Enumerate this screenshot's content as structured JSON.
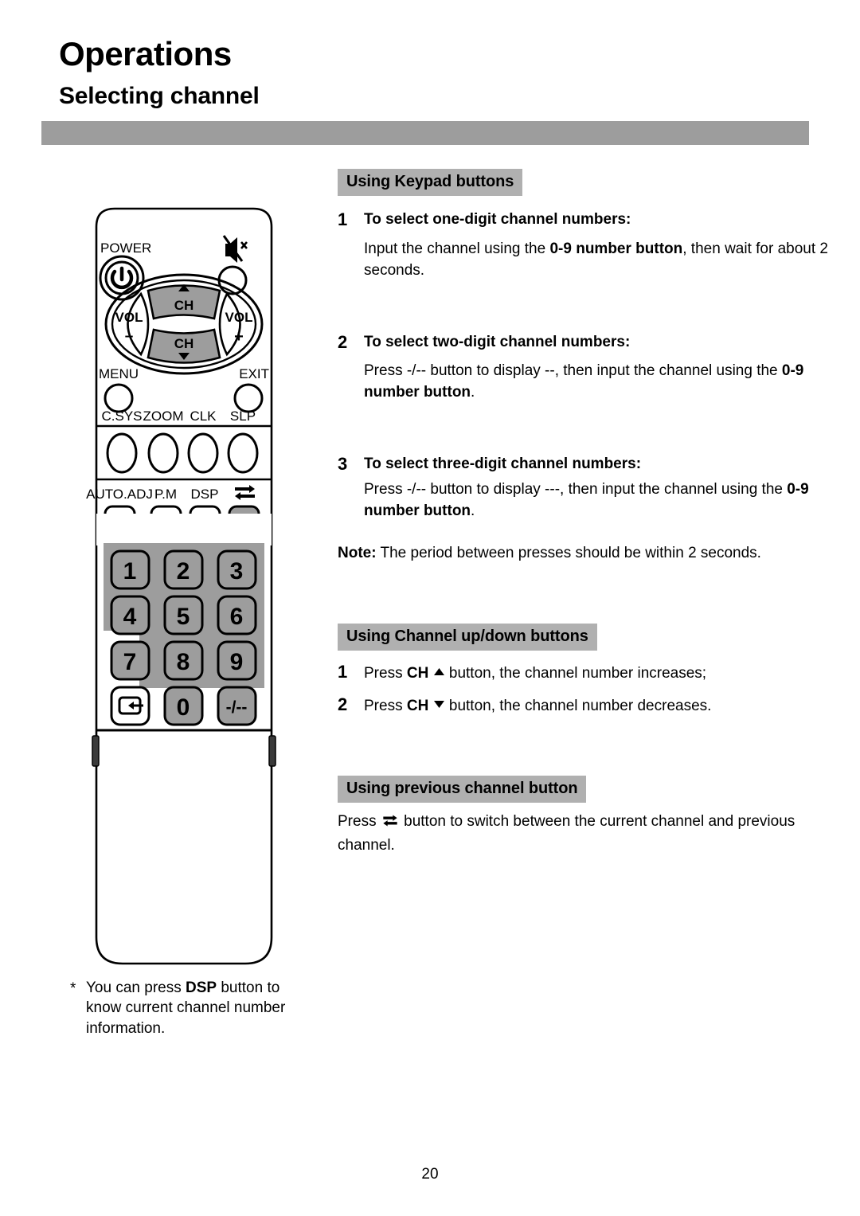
{
  "header": {
    "page_title": "Operations",
    "section_title": "Selecting channel"
  },
  "content": {
    "keypad_section": {
      "heading": "Using Keypad buttons",
      "items": [
        {
          "number": "1",
          "title": "To select one-digit channel numbers:",
          "body_pre": "Input the channel using the ",
          "body_bold": "0-9 number button",
          "body_post": ", then wait for about 2 seconds."
        },
        {
          "number": "2",
          "title": "To select two-digit channel numbers:",
          "body_pre": "Press -/-- button to display --, then input the channel using the ",
          "body_bold": "0-9 number button",
          "body_post": "."
        },
        {
          "number": "3",
          "title": "To select three-digit channel numbers:",
          "body_pre": "Press -/-- button to display ---, then input the channel using the ",
          "body_bold": "0-9 number button",
          "body_post": "."
        }
      ],
      "note_label": "Note:",
      "note_text": " The period between presses should be within 2 seconds."
    },
    "channel_updown_section": {
      "heading": "Using Channel up/down buttons",
      "lines": [
        {
          "number": "1",
          "pre": "Press ",
          "bold": "CH",
          "icon": "triangle-up-icon",
          "post": " button, the channel number increases;"
        },
        {
          "number": "2",
          "pre": "Press ",
          "bold": "CH",
          "icon": "triangle-down-icon",
          "post": " button, the channel number decreases."
        }
      ]
    },
    "previous_channel_section": {
      "heading": "Using previous channel button",
      "body_pre": "Press ",
      "body_icon": "swap-channel-icon",
      "body_post": " button to switch between the current channel and previous channel."
    }
  },
  "footnote": {
    "marker": "*",
    "pre": "You can press ",
    "bold": "DSP",
    "post": " button to know current channel number information."
  },
  "page_number": "20",
  "remote": {
    "power_label": "POWER",
    "power_icon": "power-icon",
    "mute_icon": "mute-icon",
    "dpad": {
      "ch_up_label": "CH",
      "ch_up_icon": "triangle-up-icon",
      "ch_down_label": "CH",
      "ch_down_icon": "triangle-down-icon",
      "vol_down_label": "VOL",
      "vol_down_sign": "–",
      "vol_up_label": "VOL",
      "vol_up_sign": "+"
    },
    "menu_label": "MENU",
    "exit_label": "EXIT",
    "row_csys_labels": [
      "C.SYS",
      "ZOOM",
      "CLK",
      "SLP"
    ],
    "row_auto_labels": [
      "AUTO.ADJ",
      "P.M",
      "DSP"
    ],
    "row_auto_icon": "swap-channel-icon",
    "keypad_keys": [
      "1",
      "2",
      "3",
      "4",
      "5",
      "6",
      "7",
      "8",
      "9",
      "0",
      "-/--"
    ],
    "enter_icon": "enter-icon"
  },
  "colors": {
    "heading_band": "#b0b0b0",
    "header_rule": "#9d9d9d",
    "keypad_panel": "#9d9d9d",
    "key_face": "#9d9d9d",
    "highlight_key": "#9d9d9d"
  }
}
